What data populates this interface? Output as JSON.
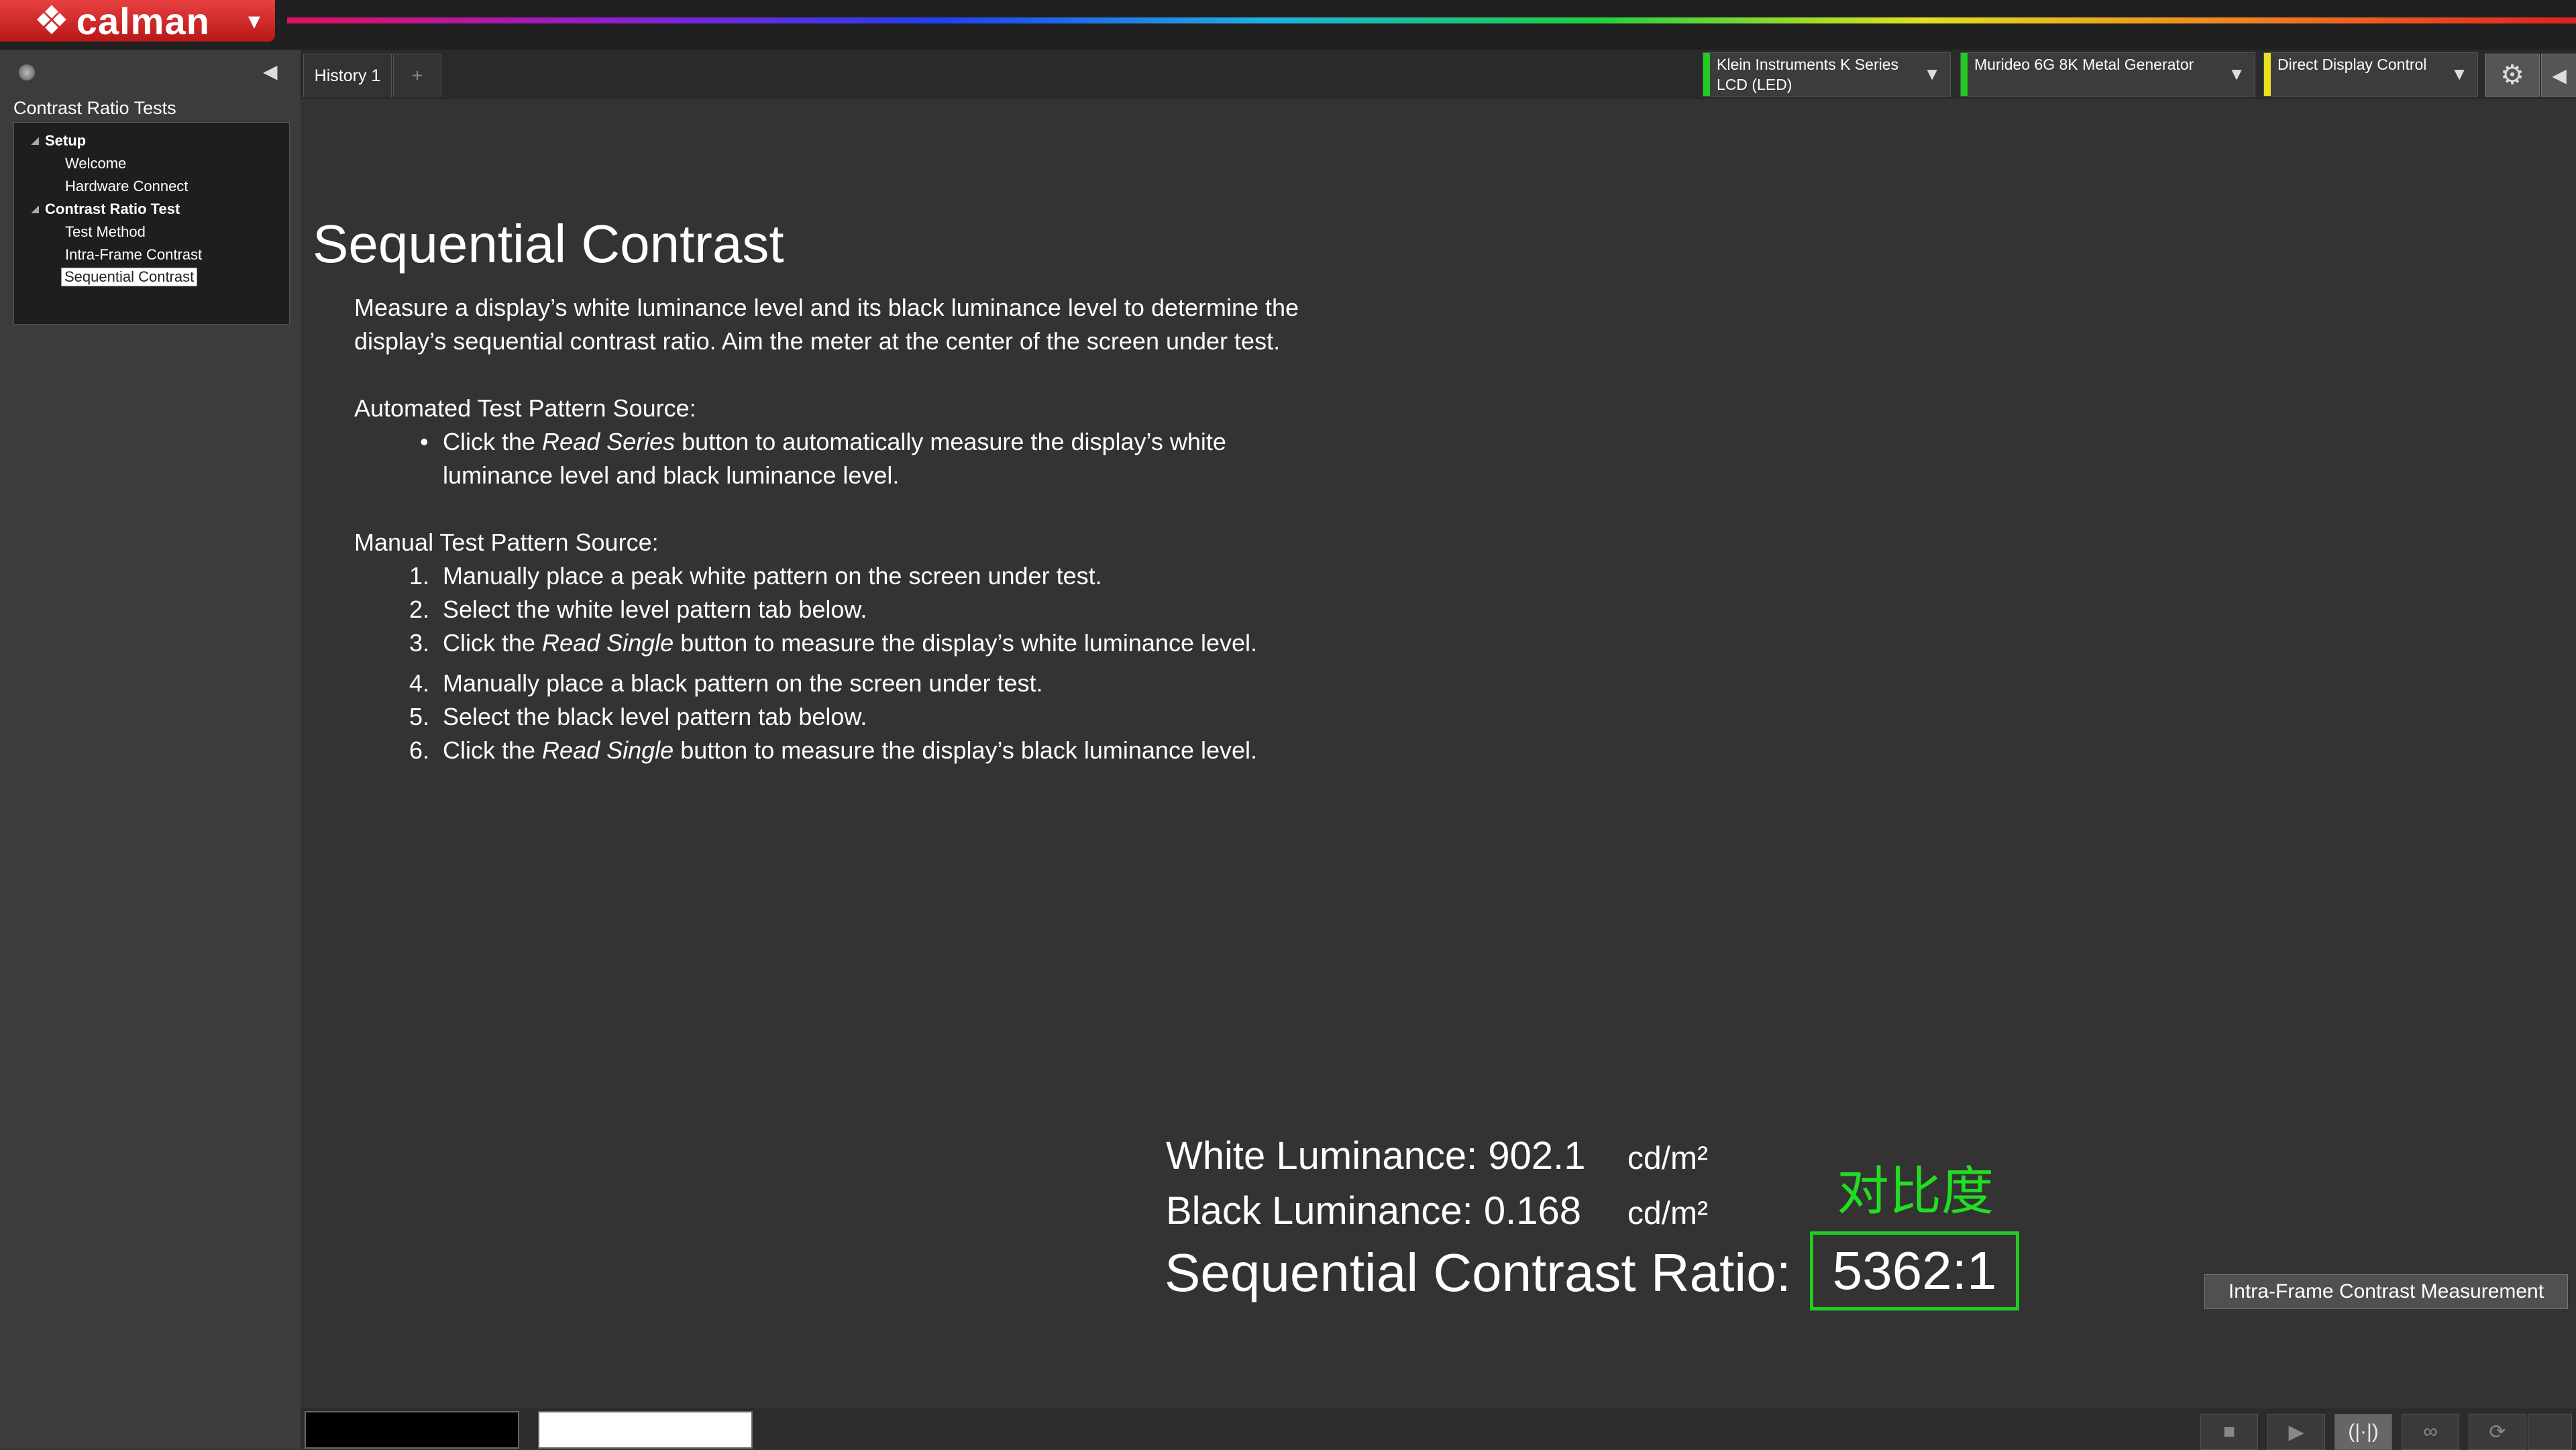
{
  "app": {
    "logo_text": "calman"
  },
  "sidebar": {
    "title": "Contrast Ratio Tests",
    "tree": [
      {
        "label": "Setup"
      },
      {
        "label": "Welcome"
      },
      {
        "label": "Hardware Connect"
      },
      {
        "label": "Contrast Ratio Test"
      },
      {
        "label": "Test Method"
      },
      {
        "label": "Intra-Frame Contrast"
      },
      {
        "label": "Sequential Contrast"
      }
    ]
  },
  "tabs": {
    "history": "History 1",
    "add": "+"
  },
  "devices": {
    "meter": {
      "line1": "Klein Instruments K Series",
      "line2": "LCD (LED)",
      "status_color": "#22cc22"
    },
    "generator": {
      "line1": "Murideo 6G 8K Metal Generator",
      "status_color": "#22cc22"
    },
    "display": {
      "line1": "Direct Display Control",
      "status_color": "#e8e020"
    }
  },
  "content": {
    "title": "Sequential Contrast",
    "intro": "Measure a display’s white luminance level and its black luminance level to determine the display’s sequential contrast ratio. Aim the meter at the center of the screen under test.",
    "auto_heading": "Automated Test Pattern Source:",
    "auto_pre": "Click the ",
    "auto_em": "Read Series",
    "auto_post": " button to automatically measure the display’s white luminance level and black luminance level.",
    "manual_heading": "Manual Test Pattern Source:",
    "steps": [
      {
        "num": "1.",
        "pre": "Manually place a peak white pattern on the screen under test.",
        "em": "",
        "post": ""
      },
      {
        "num": "2.",
        "pre": "Select the white level pattern tab below.",
        "em": "",
        "post": ""
      },
      {
        "num": "3.",
        "pre": "Click the ",
        "em": "Read Single",
        "post": " button to measure the display’s white luminance level."
      },
      {
        "num": "4.",
        "pre": "Manually place a black pattern on the screen under test.",
        "em": "",
        "post": ""
      },
      {
        "num": "5.",
        "pre": "Select the black level pattern tab below.",
        "em": "",
        "post": ""
      },
      {
        "num": "6.",
        "pre": "Click the ",
        "em": "Read Single",
        "post": " button to measure the display’s black luminance level."
      }
    ]
  },
  "results": {
    "white_label": "White Luminance: 902.1",
    "white_unit": "cd/m²",
    "black_label": "Black Luminance: 0.168",
    "black_unit": "cd/m²",
    "cjk_label": "对比度",
    "ratio_label": "Sequential Contrast Ratio:",
    "ratio_value": "5362:1",
    "highlight_color": "#22cc22"
  },
  "buttons": {
    "intra_frame": "Intra-Frame Contrast Measurement"
  },
  "controls": [
    {
      "icon": "stop-icon",
      "glyph": "■"
    },
    {
      "icon": "play-icon",
      "glyph": "▶"
    },
    {
      "icon": "read-single-icon",
      "glyph": "(|·|)"
    },
    {
      "icon": "read-continuous-icon",
      "glyph": "∞"
    },
    {
      "icon": "refresh-icon",
      "glyph": "⟳"
    },
    {
      "icon": "next-icon",
      "glyph": ""
    }
  ]
}
